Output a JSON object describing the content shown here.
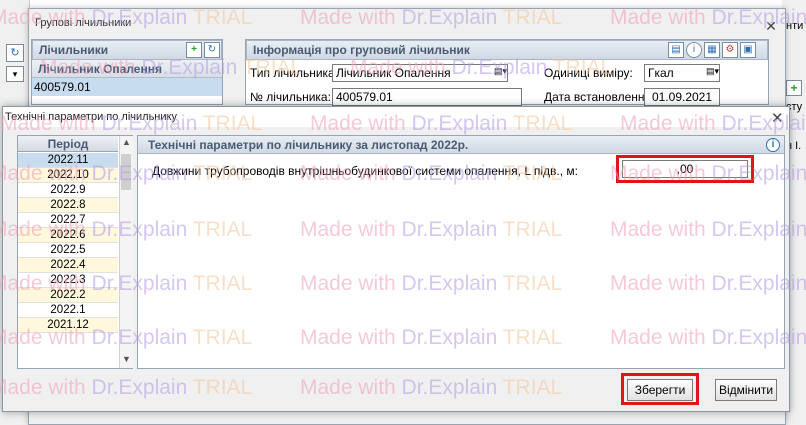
{
  "background": {
    "right_labels": [
      "нти",
      "сту",
      "н І."
    ]
  },
  "outer_dialog": {
    "title": "Групові лічильники",
    "left_panel": {
      "header": "Лічильники",
      "selected_label": "Лічильник Опалення",
      "selected_value": "400579.01"
    },
    "info_panel": {
      "header": "Інформація про груповий лічильник",
      "type_label": "Тип лічильника:",
      "type_value": "Лічильник Опалення",
      "units_label": "Одиниці виміру:",
      "units_value": "Гкал",
      "number_label": "№ лічильника:",
      "number_value": "400579.01",
      "install_label": "Дата встановлення:",
      "install_value": "01.09.2021"
    }
  },
  "inner_dialog": {
    "title": "Технічні параметри по лічильнику",
    "period_header": "Період",
    "periods": [
      "2022.11",
      "2022.10",
      "2022.9",
      "2022.8",
      "2022.7",
      "2022.6",
      "2022.5",
      "2022.4",
      "2022.3",
      "2022.2",
      "2022.1",
      "2021.12"
    ],
    "params_header": "Технічні параметри по лічильнику за листопад 2022р.",
    "param_label": "Довжини трубопроводів внутрішньобудинкової системи опалення, L підв., м:",
    "param_value": ",00",
    "save_label": "Зберегти",
    "cancel_label": "Відмінити"
  },
  "watermark": {
    "made": "Made with ",
    "brand": "Dr.Explain ",
    "trial": "TRIAL"
  },
  "colors": {
    "highlight": "#e0141b",
    "selected_row": "#c8dcf0",
    "panel_header_text": "#4a5a72"
  }
}
